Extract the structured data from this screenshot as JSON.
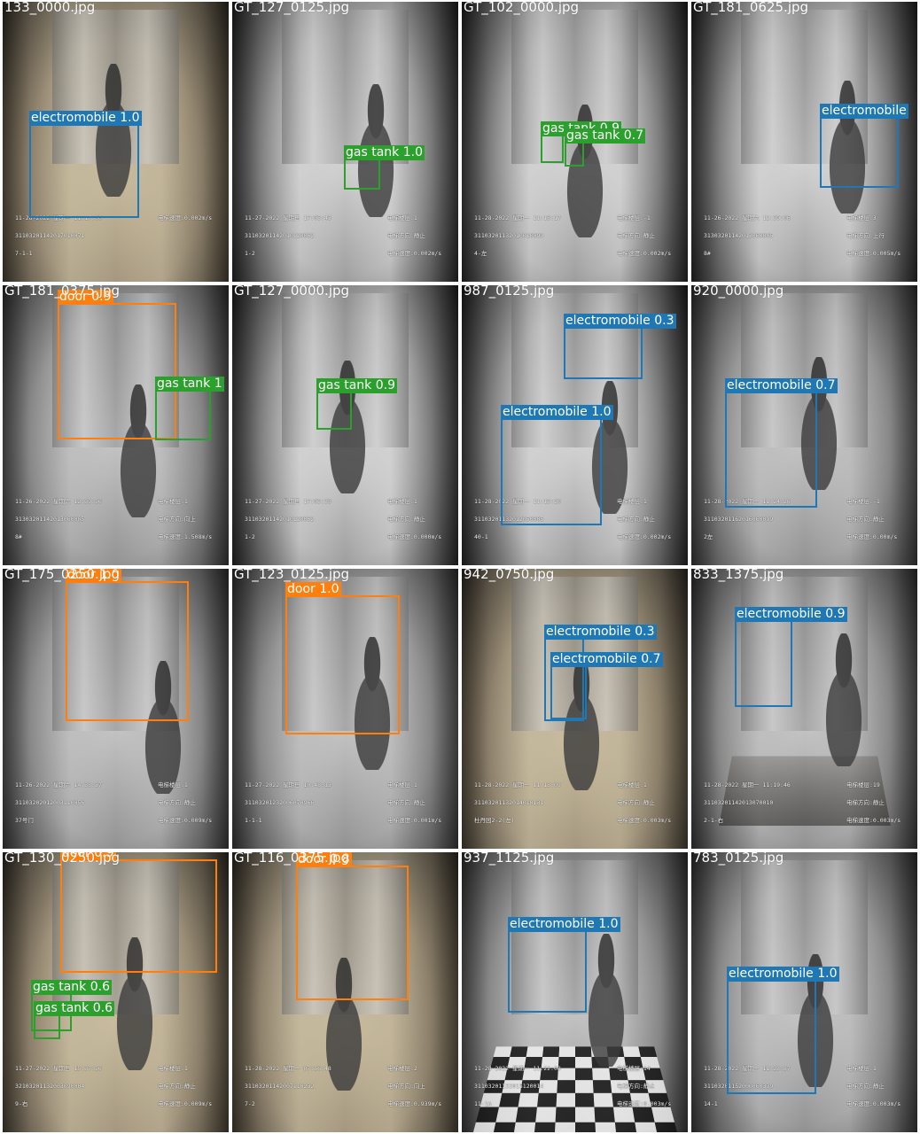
{
  "colors": {
    "electromobile": "#1f77b4",
    "gas tank": "#2ca02c",
    "door": "#ff7f0e",
    "caption": "#ffffff",
    "separator": "#ffffff"
  },
  "tiles": [
    {
      "caption": "133_0000.jpg",
      "scene": "warm",
      "boxes": [
        {
          "label": "electromobile 1.0",
          "class": "electromobile"
        }
      ],
      "osd": [
        "11-28-2022 星期一 11:17:00",
        "31103201142017010071",
        "7-1-1",
        "电梯速度:0.002m/s"
      ]
    },
    {
      "caption": "GT_127_0125.jpg",
      "scene": "gray",
      "boxes": [
        {
          "label": "gas tank 1.0",
          "class": "gas tank"
        }
      ],
      "osd": [
        "11-27-2022 星期日 17:05:43",
        "31103201142010120062",
        "1-2",
        "电梯楼层:1",
        "电梯方向:静止",
        "电梯速度:0.002m/s"
      ]
    },
    {
      "caption": "GT_102_0000.jpg",
      "scene": "gray",
      "boxes": [
        {
          "label": "gas tank 0.9",
          "class": "gas tank"
        },
        {
          "label": "gas tank 0.7",
          "class": "gas tank"
        }
      ],
      "osd": [
        "11-28-2022 星期一 11:16:17",
        "31103201132010010099",
        "4-左",
        "电梯楼层:-1",
        "电梯方向:静止",
        "电梯速度:0.002m/s"
      ]
    },
    {
      "caption": "GT_181_0625.jpg",
      "scene": "gray",
      "boxes": [
        {
          "label": "electromobile",
          "class": "electromobile"
        }
      ],
      "osd": [
        "11-26-2022 星期六 12:39:06",
        "31303201142013060005",
        "8#",
        "电梯楼层:3",
        "电梯方向:上行",
        "电梯速度:0.005m/s"
      ]
    },
    {
      "caption": "GT_181_0375.jpg",
      "scene": "base",
      "boxes": [
        {
          "label": "door 0.9",
          "class": "door"
        },
        {
          "label": "gas tank 1",
          "class": "gas tank"
        }
      ],
      "osd": [
        "11-26-2022 星期六 12:39:56",
        "31303201142013060005",
        "8#",
        "电梯楼层:1",
        "电梯方向:向上",
        "电梯速度:1.508m/s"
      ]
    },
    {
      "caption": "GT_127_0000.jpg",
      "scene": "gray",
      "boxes": [
        {
          "label": "gas tank 0.9",
          "class": "gas tank"
        }
      ],
      "osd": [
        "11-27-2022 星期日 17:05:38",
        "31103201142010120062",
        "1-2",
        "电梯楼层:1",
        "电梯方向:静止",
        "电梯速度:0.000m/s"
      ]
    },
    {
      "caption": "987_0125.jpg",
      "scene": "gray",
      "boxes": [
        {
          "label": "electromobile 0.3",
          "class": "electromobile"
        },
        {
          "label": "electromobile 1.0",
          "class": "electromobile"
        }
      ],
      "osd": [
        "11-28-2022 星期一 11:15:20",
        "31103201132012050005",
        "40-1",
        "电梯楼层:1",
        "电梯方向:静止",
        "电梯速度:0.002m/s"
      ]
    },
    {
      "caption": "920_0000.jpg",
      "scene": "base",
      "boxes": [
        {
          "label": "electromobile 0.7",
          "class": "electromobile"
        }
      ],
      "osd": [
        "11-28-2022 星期一 11:24:26",
        "31103201162016060099",
        "2左",
        "电梯楼层:-1",
        "电梯方向:静止",
        "电梯速度:0.00m/s"
      ]
    },
    {
      "caption": "GT_175_0250.jpg",
      "scene": "base",
      "boxes": [
        {
          "label": "door 1.0",
          "class": "door"
        }
      ],
      "osd": [
        "11-26-2022 星期六 14:38:37",
        "31103202012003110056",
        "37号门",
        "电梯楼层:1",
        "电梯方向:静止",
        "电梯速度:0.009m/s"
      ]
    },
    {
      "caption": "GT_123_0125.jpg",
      "scene": "base",
      "boxes": [
        {
          "label": "door 1.0",
          "class": "door"
        }
      ],
      "osd": [
        "11-27-2022 星期日 10:48:13",
        "31103201232006070966",
        "1-1-1",
        "电梯楼层:1",
        "电梯方向:静止",
        "电梯速度:0.001m/s"
      ]
    },
    {
      "caption": "942_0750.jpg",
      "scene": "warm",
      "boxes": [
        {
          "label": "electromobile 0.3",
          "class": "electromobile"
        },
        {
          "label": "electromobile 0.7",
          "class": "electromobile"
        }
      ],
      "osd": [
        "11-28-2022 星期一 11:13:09",
        "31103201132014010131",
        "杜丹园2-2(左)",
        "电梯楼层:1",
        "电梯方向:静止",
        "电梯速度:0.003m/s"
      ]
    },
    {
      "caption": "833_1375.jpg",
      "scene": "floor",
      "boxes": [
        {
          "label": "electromobile 0.9",
          "class": "electromobile"
        }
      ],
      "osd": [
        "11-28-2022 星期一 11:19:46",
        "31103201142013070010",
        "2-1-右",
        "电梯楼层:19",
        "电梯方向:静止",
        "电梯速度:0.003m/s"
      ]
    },
    {
      "caption": "GT_130_0250.jpg",
      "scene": "warm",
      "boxes": [
        {
          "label": "door 0.9",
          "class": "door"
        },
        {
          "label": "gas tank 0.6",
          "class": "gas tank"
        },
        {
          "label": "gas tank 0.6",
          "class": "gas tank"
        }
      ],
      "osd": [
        "11-27-2022 星期日 15:37:56",
        "32103201132003090004",
        "9-右",
        "电梯楼层:1",
        "电梯方向:静止",
        "电梯速度:0.009m/s"
      ]
    },
    {
      "caption": "GT_116_0375.jpg",
      "scene": "warm",
      "boxes": [
        {
          "label": "door 0.8",
          "class": "door"
        }
      ],
      "osd": [
        "11-28-2022 星期一 07:56:48",
        "31103201142007110232",
        "7-2",
        "电梯楼层:2",
        "电梯方向:向上",
        "电梯速度:0.939m/s"
      ]
    },
    {
      "caption": "937_1125.jpg",
      "scene": "checker",
      "boxes": [
        {
          "label": "electromobile 1.0",
          "class": "electromobile"
        }
      ],
      "osd": [
        "11-28-2022 星期一 11:22:08",
        "31103201132015120014",
        "11-1A",
        "电梯楼层:14",
        "电梯方向:静止",
        "电梯速度:0.003m/s"
      ]
    },
    {
      "caption": "783_0125.jpg",
      "scene": "base",
      "boxes": [
        {
          "label": "electromobile 1.0",
          "class": "electromobile"
        }
      ],
      "osd": [
        "11-28-2022 星期一 11:23:37",
        "31103201152000060339",
        "14-1",
        "电梯楼层:1",
        "电梯方向:静止",
        "电梯速度:0.003m/s"
      ]
    }
  ]
}
